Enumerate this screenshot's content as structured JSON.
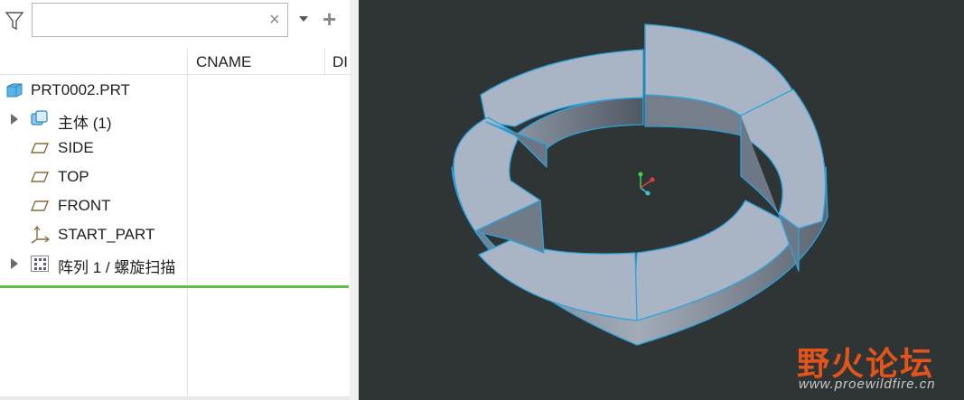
{
  "search": {
    "value": "",
    "placeholder": "",
    "clear_glyph": "×",
    "add_glyph": "+"
  },
  "columns": [
    {
      "label": "CNAME"
    },
    {
      "label": "DI"
    }
  ],
  "tree": {
    "root": {
      "label": "PRT0002.PRT",
      "icon": "part-icon"
    },
    "items": [
      {
        "label": "主体 (1)",
        "icon": "body-icon",
        "expandable": true
      },
      {
        "label": "SIDE",
        "icon": "datum-plane-icon",
        "expandable": false
      },
      {
        "label": "TOP",
        "icon": "datum-plane-icon",
        "expandable": false
      },
      {
        "label": "FRONT",
        "icon": "datum-plane-icon",
        "expandable": false
      },
      {
        "label": "START_PART",
        "icon": "coordinate-system-icon",
        "expandable": false
      },
      {
        "label": "阵列 1 / 螺旋扫描",
        "icon": "pattern-icon",
        "expandable": true
      }
    ]
  },
  "insert_indicator_color": "#5fbf4a",
  "viewport": {
    "background": "#2f3435",
    "model_face_color": "#a9b5c5",
    "edge_color": "#2ba4e0"
  },
  "watermark": {
    "chinese": "野火论坛",
    "url": "www.proewildfire.cn",
    "color": "#e2541b"
  }
}
